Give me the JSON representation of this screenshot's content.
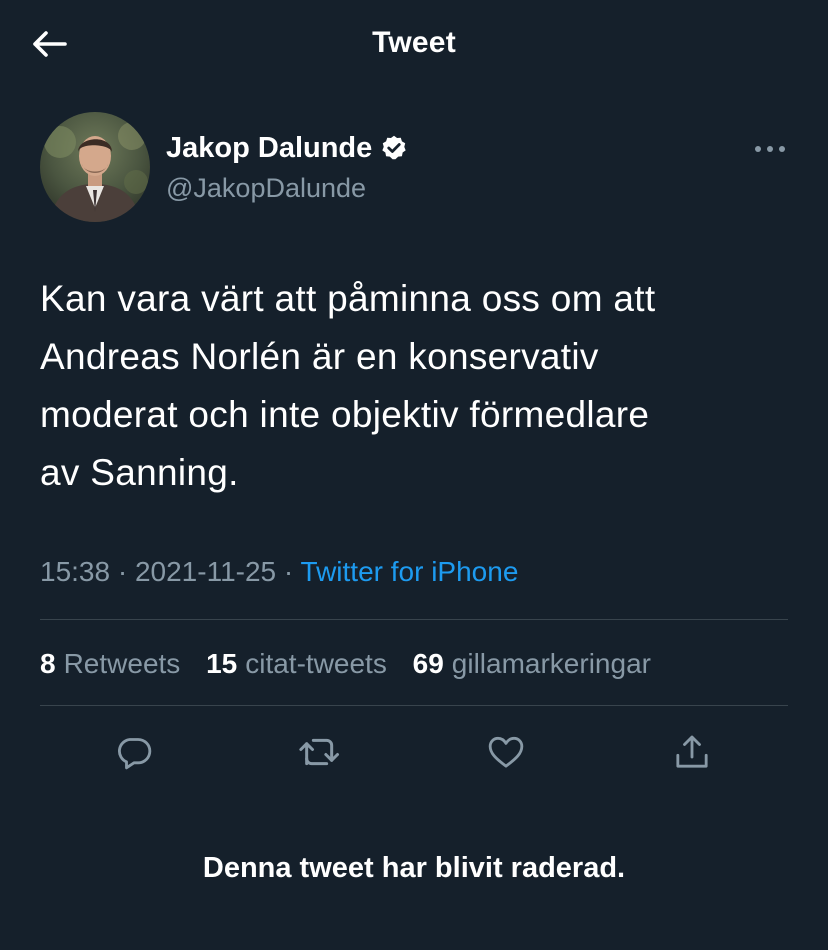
{
  "header": {
    "title": "Tweet",
    "back_icon": "arrow-left-icon"
  },
  "author": {
    "name": "Jakop Dalunde",
    "handle": "@JakopDalunde",
    "verified": true,
    "verified_icon": "verified-badge-icon",
    "avatar_icon": "profile-photo"
  },
  "more_icon": "more-horizontal-icon",
  "tweet": {
    "text": "Kan vara värt att påminna oss om att\nAndreas Norlén är en konservativ\nmoderat och inte objektiv förmedlare\nav Sanning.",
    "time": "15:38",
    "separator": " · ",
    "date": "2021-11-25",
    "source": "Twitter for iPhone"
  },
  "stats": {
    "retweets_count": "8",
    "retweets_label": "Retweets",
    "quotes_count": "15",
    "quotes_label": "citat-tweets",
    "likes_count": "69",
    "likes_label": "gillamarkeringar"
  },
  "actions": [
    {
      "name": "reply",
      "icon": "reply-icon"
    },
    {
      "name": "retweet",
      "icon": "retweet-icon"
    },
    {
      "name": "like",
      "icon": "heart-icon"
    },
    {
      "name": "share",
      "icon": "share-icon"
    }
  ],
  "notice": "Denna tweet har blivit raderad.",
  "colors": {
    "background": "#15202b",
    "text_primary": "#ffffff",
    "text_secondary": "#8899a6",
    "accent": "#1d9bf0",
    "divider": "#38444d"
  }
}
